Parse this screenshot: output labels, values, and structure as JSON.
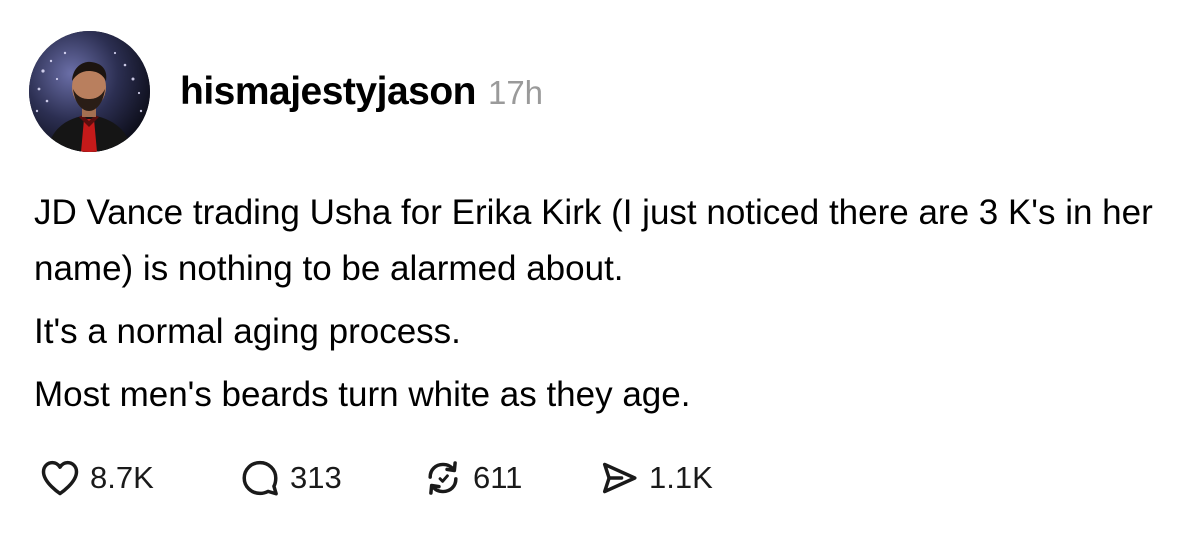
{
  "post": {
    "author": {
      "username": "hismajestyjason",
      "timestamp": "17h",
      "avatar_icon": "profile-photo"
    },
    "paragraphs": [
      "JD Vance trading Usha for Erika Kirk (I just noticed there are 3 K's in her name) is nothing to be alarmed about.",
      "It's a normal aging process.",
      "Most men's beards turn white as they age."
    ],
    "actions": {
      "like": {
        "icon": "heart-icon",
        "count": "8.7K"
      },
      "reply": {
        "icon": "comment-icon",
        "count": "313"
      },
      "repost": {
        "icon": "repost-icon",
        "count": "611"
      },
      "share": {
        "icon": "send-icon",
        "count": "1.1K"
      }
    }
  },
  "colors": {
    "text": "#000000",
    "muted": "#9a9a9a",
    "background": "#ffffff"
  }
}
